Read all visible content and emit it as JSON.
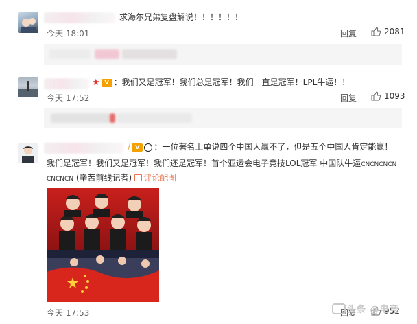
{
  "comments": [
    {
      "text": "求海尔兄弟复盘解说！！！！！！",
      "time": "今天 18:01",
      "reply_label": "回复",
      "likes": "2081"
    },
    {
      "text": "：我们又是冠军！我们总是冠军！我们一直是冠军！LPL牛逼！！",
      "time": "今天 17:52",
      "reply_label": "回复",
      "likes": "1093"
    },
    {
      "text_line1": "：一位著名上单说四个中国人赢不了，但是五个中国人肯定能赢！",
      "text_line2": "我们是冠军！我们又是冠军！我们还是冠军！首个亚运会电子竞技LOL冠军  中国队牛逼",
      "text_line2_small": "CNCNCNCN",
      "text_line3_small": "CNCNCN",
      "text_line3": " (辛苦前线记者)",
      "pic_link": "评论配图",
      "time": "今天 17:53",
      "reply_label": "回复",
      "likes": "952"
    }
  ],
  "watermark": "头条 @电竞",
  "colors": {
    "link": "#eb7350",
    "meta": "#666666",
    "reply_bg": "#f5f5f5"
  },
  "icons": [
    "thumbs-up-icon",
    "star-icon",
    "vip-badge-icon",
    "panda-icon",
    "picture-icon"
  ]
}
